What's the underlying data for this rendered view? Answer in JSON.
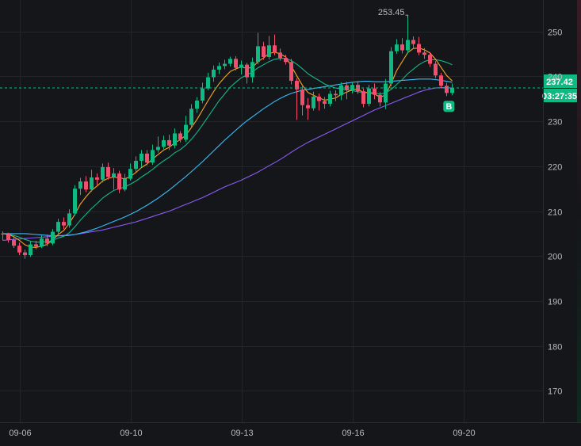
{
  "chart_data": {
    "type": "candlestick",
    "ylim": [
      163,
      257
    ],
    "y_ticks": [
      {
        "value": 250,
        "label": "250"
      },
      {
        "value": 240,
        "label": "240"
      },
      {
        "value": 230,
        "label": "230"
      },
      {
        "value": 220,
        "label": "220"
      },
      {
        "value": 210,
        "label": "210"
      },
      {
        "value": 200,
        "label": "200"
      },
      {
        "value": 190,
        "label": "190"
      },
      {
        "value": 180,
        "label": "180"
      },
      {
        "value": 170,
        "label": "170"
      }
    ],
    "x_ticks": [
      {
        "label": "09-06",
        "index": 3
      },
      {
        "label": "09-10",
        "index": 23
      },
      {
        "label": "09-13",
        "index": 43
      },
      {
        "label": "09-16",
        "index": 63
      },
      {
        "label": "09-20",
        "index": 83
      }
    ],
    "grid": true,
    "candles": [
      [
        205,
        204.8,
        205.5,
        203.5
      ],
      [
        204.8,
        203.6,
        205.2,
        203
      ],
      [
        203.6,
        202.3,
        204.2,
        201.8
      ],
      [
        202.3,
        200.8,
        203,
        200.2
      ],
      [
        200.8,
        200.2,
        201.4,
        199.4
      ],
      [
        200.2,
        202.6,
        203.2,
        199.8
      ],
      [
        202.6,
        202.1,
        203.4,
        201.5
      ],
      [
        202.1,
        203.9,
        204.6,
        201.8
      ],
      [
        203.9,
        202.8,
        204.8,
        202.2
      ],
      [
        202.8,
        205.4,
        206,
        202.4
      ],
      [
        205.4,
        207.6,
        208.3,
        204.9
      ],
      [
        207.6,
        206.8,
        208.6,
        206
      ],
      [
        206.8,
        209.5,
        210.4,
        206.3
      ],
      [
        209.5,
        215,
        215.8,
        209
      ],
      [
        215,
        216.6,
        217.4,
        213.6
      ],
      [
        216.6,
        214.8,
        217.8,
        214.2
      ],
      [
        214.8,
        217.5,
        219.2,
        214.3
      ],
      [
        217.5,
        217,
        218.4,
        215.8
      ],
      [
        217,
        219.8,
        220.6,
        216.4
      ],
      [
        219.8,
        217.6,
        220.8,
        217
      ],
      [
        217.6,
        218.4,
        219.6,
        214.8
      ],
      [
        218.4,
        214.8,
        219,
        214
      ],
      [
        214.8,
        217.2,
        218.3,
        214.4
      ],
      [
        217.2,
        219.4,
        220.6,
        216.8
      ],
      [
        219.4,
        221.2,
        222.2,
        218.8
      ],
      [
        221.2,
        222.8,
        223.6,
        219.8
      ],
      [
        222.8,
        220.8,
        223.6,
        220.2
      ],
      [
        220.8,
        223.6,
        224.8,
        220.3
      ],
      [
        223.6,
        224.3,
        226.6,
        223
      ],
      [
        224.3,
        225.8,
        226.8,
        223.8
      ],
      [
        225.8,
        224.6,
        227,
        223.6
      ],
      [
        224.6,
        227.3,
        228.4,
        224
      ],
      [
        227.3,
        225.9,
        227.8,
        225.3
      ],
      [
        225.9,
        229.2,
        231.2,
        225.4
      ],
      [
        229.2,
        232.8,
        233.8,
        228.7
      ],
      [
        232.8,
        234.6,
        235.4,
        231.9
      ],
      [
        234.6,
        237.3,
        238.6,
        234
      ],
      [
        237.3,
        239.8,
        240.8,
        236.9
      ],
      [
        239.8,
        241.5,
        242.4,
        238.8
      ],
      [
        241.5,
        242.3,
        243.1,
        240.5
      ],
      [
        242.3,
        242.8,
        243.7,
        241.6
      ],
      [
        242.8,
        243.9,
        244.4,
        242.2
      ],
      [
        243.9,
        241.9,
        244.5,
        241.3
      ],
      [
        241.9,
        242.6,
        243.5,
        240.4
      ],
      [
        242.6,
        239.8,
        243,
        238.4
      ],
      [
        239.8,
        243.2,
        244.2,
        238.6
      ],
      [
        243.2,
        246.7,
        249.7,
        242.7
      ],
      [
        246.7,
        244.3,
        247.7,
        243.7
      ],
      [
        244.3,
        246.9,
        249,
        243.8
      ],
      [
        246.9,
        245.3,
        249.3,
        244.7
      ],
      [
        245.3,
        244.1,
        246.2,
        243.5
      ],
      [
        244.1,
        243.2,
        244.8,
        242.6
      ],
      [
        243.2,
        239,
        243.9,
        238.2
      ],
      [
        239,
        237.1,
        239.6,
        230.3
      ],
      [
        237.1,
        233.6,
        237.8,
        231.3
      ],
      [
        233.6,
        232.9,
        235.2,
        230.3
      ],
      [
        232.9,
        235.5,
        236.6,
        232.4
      ],
      [
        235.5,
        234.5,
        236.2,
        232.4
      ],
      [
        234.5,
        233.9,
        235.4,
        232.8
      ],
      [
        233.9,
        236.1,
        236.8,
        233.3
      ],
      [
        236.1,
        235.8,
        236.9,
        234.5
      ],
      [
        235.8,
        238,
        238.7,
        234.7
      ],
      [
        238,
        236.9,
        238.8,
        234.9
      ],
      [
        236.9,
        238.1,
        238.8,
        236.2
      ],
      [
        238.1,
        236.7,
        239,
        236.1
      ],
      [
        236.7,
        233.9,
        237.3,
        233.1
      ],
      [
        233.9,
        237.3,
        238.1,
        233.3
      ],
      [
        237.3,
        235.9,
        238.4,
        234.9
      ],
      [
        235.9,
        234.2,
        236.5,
        233.3
      ],
      [
        234.2,
        238.4,
        239.4,
        232.7
      ],
      [
        238.4,
        245.6,
        246.5,
        237.8
      ],
      [
        245.6,
        247.1,
        248.3,
        245
      ],
      [
        247.1,
        245.8,
        248.5,
        245.1
      ],
      [
        245.8,
        248.1,
        253.45,
        245.2
      ],
      [
        248.1,
        247.2,
        248.9,
        246.2
      ],
      [
        247.2,
        245.3,
        248.8,
        244.7
      ],
      [
        245.3,
        244.8,
        246.3,
        243.9
      ],
      [
        244.8,
        242.8,
        245.4,
        242.1
      ],
      [
        242.8,
        240.2,
        243.4,
        239.6
      ],
      [
        240.2,
        237.9,
        240.8,
        237.3
      ],
      [
        237.9,
        236.3,
        238.6,
        235.6
      ],
      [
        236.3,
        237.42,
        238.4,
        235.8
      ]
    ],
    "ma_fast": [
      205,
      204.8,
      204.3,
      203.5,
      202.5,
      202.0,
      201.9,
      202.2,
      202.6,
      203.6,
      204.8,
      205.7,
      207.3,
      209.3,
      211.6,
      213.2,
      214.6,
      215.6,
      216.7,
      217.3,
      217.6,
      217.4,
      217.2,
      217.7,
      218.6,
      219.7,
      220.5,
      221.6,
      222.6,
      223.6,
      224.2,
      225.2,
      225.9,
      226.9,
      228.6,
      230.4,
      232.5,
      234.6,
      236.6,
      238.4,
      239.8,
      241.1,
      241.7,
      242.1,
      241.8,
      242.0,
      243.3,
      244.1,
      245.1,
      245.4,
      245.0,
      244.3,
      242.3,
      240.1,
      238.0,
      236.4,
      235.8,
      235.2,
      234.7,
      234.9,
      235.2,
      236.0,
      236.5,
      237.0,
      237.2,
      236.4,
      236.4,
      236.1,
      235.3,
      235.9,
      238.4,
      241.3,
      243.3,
      245.3,
      246.2,
      246.3,
      245.9,
      245.2,
      243.8,
      242.0,
      240.2,
      239.0
    ],
    "ma_mid": [
      205,
      204.9,
      204.6,
      204.2,
      203.7,
      203.3,
      203.1,
      203.1,
      203.2,
      203.5,
      204.0,
      204.4,
      205.2,
      206.5,
      208.0,
      209.3,
      210.6,
      211.7,
      212.9,
      213.8,
      214.6,
      215.0,
      215.4,
      216.0,
      216.7,
      217.6,
      218.4,
      219.3,
      220.3,
      221.2,
      222.0,
      223.0,
      223.7,
      224.7,
      226.0,
      227.5,
      229.2,
      231.0,
      232.8,
      234.6,
      236.1,
      237.6,
      238.7,
      239.7,
      240.3,
      241.0,
      241.9,
      242.6,
      243.3,
      243.8,
      244.0,
      244.0,
      243.5,
      242.7,
      241.7,
      240.6,
      239.8,
      239.1,
      238.3,
      237.8,
      237.4,
      237.2,
      237.0,
      236.8,
      236.6,
      236.4,
      236.4,
      236.3,
      236.1,
      236.3,
      237.1,
      238.2,
      239.3,
      240.6,
      241.6,
      242.6,
      243.3,
      243.7,
      243.7,
      243.5,
      243.1,
      242.6
    ],
    "ma_slow": [
      205,
      205,
      205,
      205,
      205,
      204.9,
      204.8,
      204.7,
      204.6,
      204.5,
      204.5,
      204.5,
      204.6,
      204.8,
      205.1,
      205.4,
      205.8,
      206.2,
      206.7,
      207.2,
      207.7,
      208.2,
      208.7,
      209.3,
      209.9,
      210.6,
      211.3,
      212.1,
      212.9,
      213.8,
      214.7,
      215.7,
      216.7,
      217.7,
      218.8,
      219.9,
      221.0,
      222.2,
      223.4,
      224.6,
      225.8,
      226.9,
      228.0,
      229.1,
      230.1,
      231.0,
      231.9,
      232.8,
      233.6,
      234.4,
      235.1,
      235.7,
      236.2,
      236.6,
      236.9,
      237.1,
      237.3,
      237.5,
      237.7,
      237.9,
      238.1,
      238.3,
      238.5,
      238.7,
      238.8,
      238.9,
      238.9,
      238.8,
      238.8,
      238.8,
      238.9,
      239.0,
      239.1,
      239.2,
      239.3,
      239.4,
      239.4,
      239.4,
      239.3,
      239.1,
      238.9,
      238.7
    ],
    "ma_long": [
      203.5,
      203.6,
      203.7,
      203.8,
      203.9,
      204.0,
      204.1,
      204.2,
      204.3,
      204.4,
      204.5,
      204.6,
      204.7,
      204.8,
      205.0,
      205.2,
      205.4,
      205.6,
      205.8,
      206.1,
      206.4,
      206.7,
      207.0,
      207.3,
      207.6,
      208.0,
      208.4,
      208.8,
      209.2,
      209.6,
      210.0,
      210.5,
      211.0,
      211.5,
      212.0,
      212.5,
      213.0,
      213.6,
      214.2,
      214.8,
      215.4,
      215.9,
      216.4,
      216.9,
      217.5,
      218.1,
      218.7,
      219.4,
      220.1,
      220.8,
      221.5,
      222.3,
      223.1,
      223.9,
      224.6,
      225.3,
      225.9,
      226.5,
      227.1,
      227.7,
      228.3,
      228.9,
      229.5,
      230.1,
      230.7,
      231.3,
      231.9,
      232.5,
      233.0,
      233.5,
      234.0,
      234.5,
      235.0,
      235.5,
      236.0,
      236.5,
      236.9,
      237.2,
      237.4,
      237.5,
      237.5,
      237.4
    ],
    "high_marker": {
      "value": 253.45,
      "label": "253.45"
    },
    "last_price": {
      "value": 237.42,
      "label": "237.42"
    },
    "countdown": "03:27:35",
    "buy_marker": {
      "label": "B"
    },
    "colors": {
      "background": "#15161a",
      "grid": "#23252b",
      "up": "#10b981",
      "down": "#f0506e",
      "ma_fast": "#f5a623",
      "ma_mid": "#14b88a",
      "ma_slow": "#38bdf8",
      "ma_long": "#8b5cf6",
      "price_line": "#10b981",
      "axis_text": "#b7bac1",
      "right_gradient_top": "#3a1c25",
      "right_gradient_bottom": "#10291f"
    }
  }
}
